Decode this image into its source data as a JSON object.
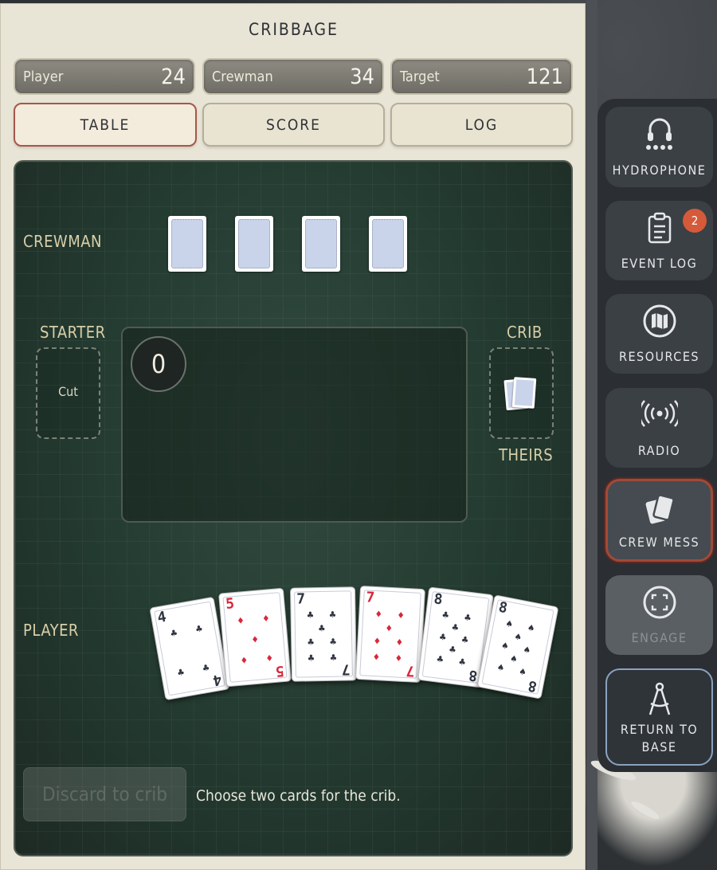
{
  "game": {
    "title": "CRIBBAGE",
    "stats": [
      {
        "label": "Player",
        "value": "24"
      },
      {
        "label": "Crewman",
        "value": "34"
      },
      {
        "label": "Target",
        "value": "121"
      }
    ],
    "tabs": [
      {
        "label": "TABLE",
        "active": true
      },
      {
        "label": "SCORE",
        "active": false
      },
      {
        "label": "LOG",
        "active": false
      }
    ],
    "zones": {
      "crewman": "CREWMAN",
      "starter": "STARTER",
      "starter_slot": "Cut",
      "crib": "CRIB",
      "crib_owner": "THEIRS",
      "player": "PLAYER"
    },
    "running_count": "0",
    "crewman_cards_face_down": 4,
    "player_hand": [
      {
        "rank": "4",
        "suit": "clubs",
        "suit_symbol": "♣",
        "color": "#2f3440"
      },
      {
        "rank": "5",
        "suit": "diamonds",
        "suit_symbol": "♦",
        "color": "#d8283c"
      },
      {
        "rank": "7",
        "suit": "clubs",
        "suit_symbol": "♣",
        "color": "#2f3440"
      },
      {
        "rank": "7",
        "suit": "diamonds",
        "suit_symbol": "♦",
        "color": "#d8283c"
      },
      {
        "rank": "8",
        "suit": "clubs",
        "suit_symbol": "♣",
        "color": "#2f3440"
      },
      {
        "rank": "8",
        "suit": "spades",
        "suit_symbol": "♠",
        "color": "#2f3440"
      }
    ],
    "discard_button": "Discard to crib",
    "hint": "Choose two cards for the crib."
  },
  "dock": {
    "items": [
      {
        "label": "HYDROPHONE",
        "icon": "headphones-icon"
      },
      {
        "label": "EVENT LOG",
        "icon": "clipboard-icon",
        "badge": "2"
      },
      {
        "label": "RESOURCES",
        "icon": "map-icon"
      },
      {
        "label": "RADIO",
        "icon": "broadcast-icon"
      },
      {
        "label": "CREW MESS",
        "icon": "cards-icon",
        "active": true
      },
      {
        "label": "ENGAGE",
        "icon": "target-frame-icon",
        "disabled": true
      },
      {
        "label": "RETURN TO BASE",
        "icon": "compass-icon"
      }
    ]
  }
}
